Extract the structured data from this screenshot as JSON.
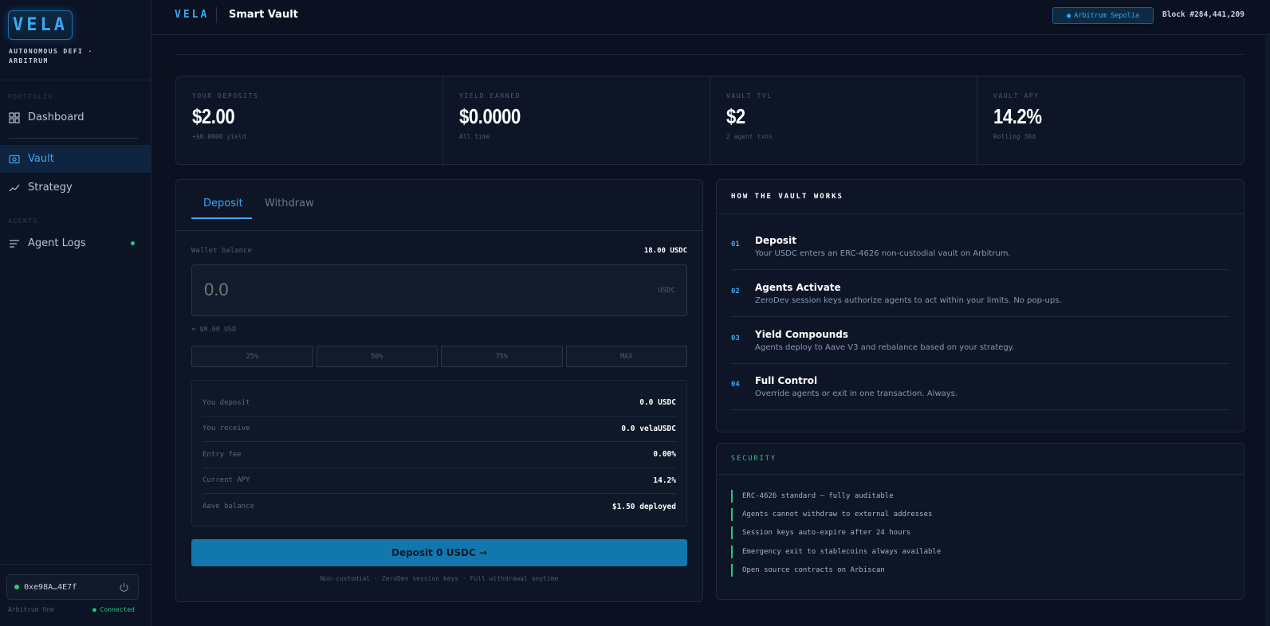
{
  "sidebar": {
    "logo": "VELA",
    "tagline": "AUTONOMOUS DEFI · ARBITRUM",
    "sections": {
      "portfolio": "PORTFOLIO",
      "agents": "AGENTS"
    },
    "items": [
      {
        "label": "Dashboard",
        "icon": "grid-icon"
      },
      {
        "label": "Vault",
        "icon": "vault-icon",
        "active": true
      },
      {
        "label": "Strategy",
        "icon": "trend-icon"
      },
      {
        "label": "Agent Logs",
        "icon": "list-icon",
        "live": true
      }
    ],
    "wallet": {
      "address": "0xe98A…4E7f",
      "network": "Arbitrum One",
      "status": "Connected"
    }
  },
  "header": {
    "brand": "VELA",
    "title": "Smart Vault",
    "network_pill": "Arbitrum Sepolia",
    "block": "Block #284,441,209"
  },
  "stats": [
    {
      "label": "YOUR DEPOSITS",
      "value": "$2.00",
      "sub": "+$0.0000 yield"
    },
    {
      "label": "YIELD EARNED",
      "value": "$0.0000",
      "sub": "All time"
    },
    {
      "label": "VAULT TVL",
      "value": "$2",
      "sub": "2 agent txns"
    },
    {
      "label": "VAULT APY",
      "value": "14.2%",
      "sub": "Rolling 30d"
    }
  ],
  "deposit": {
    "tabs": [
      "Deposit",
      "Withdraw"
    ],
    "wallet_balance_label": "Wallet balance",
    "wallet_balance_value": "18.00 USDC",
    "amount_placeholder": "0.0",
    "amount_unit": "USDC",
    "usd_equiv": "≈ $0.00 USD",
    "pct_buttons": [
      "25%",
      "50%",
      "75%",
      "MAX"
    ],
    "summary": [
      {
        "label": "You deposit",
        "value": "0.0 USDC"
      },
      {
        "label": "You receive",
        "value": "0.0 velaUSDC"
      },
      {
        "label": "Entry fee",
        "value": "0.00%"
      },
      {
        "label": "Current APY",
        "value": "14.2%"
      },
      {
        "label": "Aave balance",
        "value": "$1.50 deployed"
      }
    ],
    "cta": "Deposit 0 USDC →",
    "footnote": "Non-custodial · ZeroDev session keys · Full withdrawal anytime"
  },
  "how": {
    "title": "HOW THE VAULT WORKS",
    "steps": [
      {
        "num": "01",
        "title": "Deposit",
        "desc": "Your USDC enters an ERC-4626 non-custodial vault on Arbitrum."
      },
      {
        "num": "02",
        "title": "Agents Activate",
        "desc": "ZeroDev session keys authorize agents to act within your limits. No pop-ups."
      },
      {
        "num": "03",
        "title": "Yield Compounds",
        "desc": "Agents deploy to Aave V3 and rebalance based on your strategy."
      },
      {
        "num": "04",
        "title": "Full Control",
        "desc": "Override agents or exit in one transaction. Always."
      }
    ]
  },
  "security": {
    "title": "SECURITY",
    "items": [
      "ERC-4626 standard — fully auditable",
      "Agents cannot withdraw to external addresses",
      "Session keys auto-expire after 24 hours",
      "Emergency exit to stablecoins always available",
      "Open source contracts on Arbiscan"
    ]
  },
  "colors": {
    "accent": "#3aa8f2",
    "success": "#27c97c",
    "cta": "#1277ad",
    "bg": "#0b1120"
  }
}
